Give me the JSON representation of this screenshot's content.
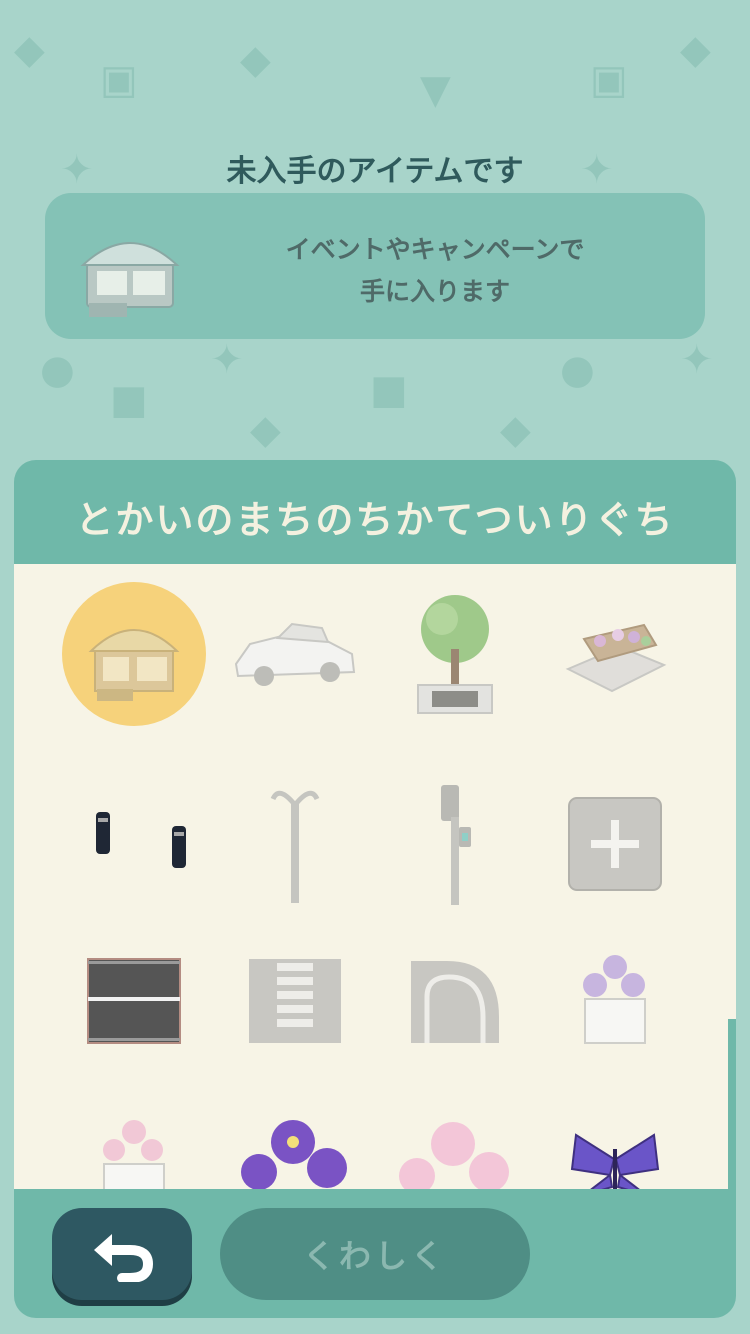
{
  "notice": {
    "title": "未入手のアイテムです",
    "line1": "イベントやキャンペーンで",
    "line2": "手に入ります",
    "item_icon": "kiosk-icon"
  },
  "panel": {
    "title": "とかいのまちのちかてついりぐち",
    "items": [
      {
        "icon": "kiosk-icon",
        "selected": true
      },
      {
        "icon": "car-icon"
      },
      {
        "icon": "tree-planter-icon"
      },
      {
        "icon": "flowerbed-icon"
      },
      {
        "icon": "bollards-icon"
      },
      {
        "icon": "streetlamp-icon"
      },
      {
        "icon": "traffic-light-icon"
      },
      {
        "icon": "add-tile-icon"
      },
      {
        "icon": "road-straight-icon"
      },
      {
        "icon": "crosswalk-icon"
      },
      {
        "icon": "road-curve-icon"
      },
      {
        "icon": "purple-flower-planter-icon"
      },
      {
        "icon": "pink-flower-planter-icon"
      },
      {
        "icon": "purple-pansy-icon"
      },
      {
        "icon": "pink-flower-icon"
      },
      {
        "icon": "butterfly-icon"
      }
    ]
  },
  "buttons": {
    "back_icon": "undo-arrow-icon",
    "detail_label": "くわしく"
  },
  "colors": {
    "background": "#a8d4ca",
    "panel": "#6fb8a9",
    "grid_bg": "#f7f4e6",
    "selected": "#f6d27b",
    "back_button": "#2e5862"
  }
}
